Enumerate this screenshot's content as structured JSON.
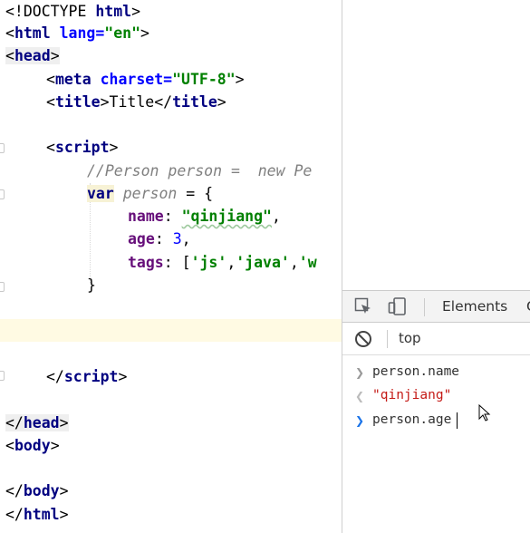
{
  "editor": {
    "lines": {
      "l1": {
        "a": "<!DOCTYPE ",
        "b": "html",
        "c": ">"
      },
      "l2": {
        "a": "<",
        "b": "html ",
        "c": "lang=",
        "d": "\"en\"",
        "e": ">"
      },
      "l3": {
        "a": "<",
        "b": "head",
        "c": ">"
      },
      "l4": {
        "a": "<",
        "b": "meta ",
        "c": "charset=",
        "d": "\"UTF-8\"",
        "e": ">"
      },
      "l5": {
        "a": "<",
        "b": "title",
        "c": ">",
        "d": "Title",
        "e": "</",
        "f": "title",
        "g": ">"
      },
      "l7": {
        "a": "<",
        "b": "script",
        "c": ">"
      },
      "l8": {
        "a": "//Person person =  new Pe"
      },
      "l9": {
        "a": "var",
        "b": " ",
        "c": "person",
        "d": " = {"
      },
      "l10": {
        "a": "name",
        "b": ": ",
        "c": "\"qinjiang\"",
        "d": ","
      },
      "l11": {
        "a": "age",
        "b": ": ",
        "c": "3",
        "d": ","
      },
      "l12": {
        "a": "tags",
        "b": ": [",
        "c": "'js'",
        "d": ",",
        "e": "'java'",
        "f": ",",
        "g": "'w"
      },
      "l13": {
        "a": "}"
      },
      "l16": {
        "a": "</",
        "b": "script",
        "c": ">"
      },
      "l18": {
        "a": "</",
        "b": "head",
        "c": ">"
      },
      "l19": {
        "a": "<",
        "b": "body",
        "c": ">"
      },
      "l21": {
        "a": "</",
        "b": "body",
        "c": ">"
      },
      "l22": {
        "a": "</",
        "b": "html",
        "c": ">"
      }
    }
  },
  "devtools": {
    "tabs": {
      "elements": "Elements",
      "next": "C"
    },
    "filter": {
      "context": "top"
    },
    "console": {
      "input1": "person.name",
      "output1": "\"qinjiang\"",
      "input2": "person.age"
    },
    "colors": {
      "output_string": "#c41a16",
      "prompt_chevron": "#1a73e8",
      "history_chevron": "#999999"
    }
  }
}
